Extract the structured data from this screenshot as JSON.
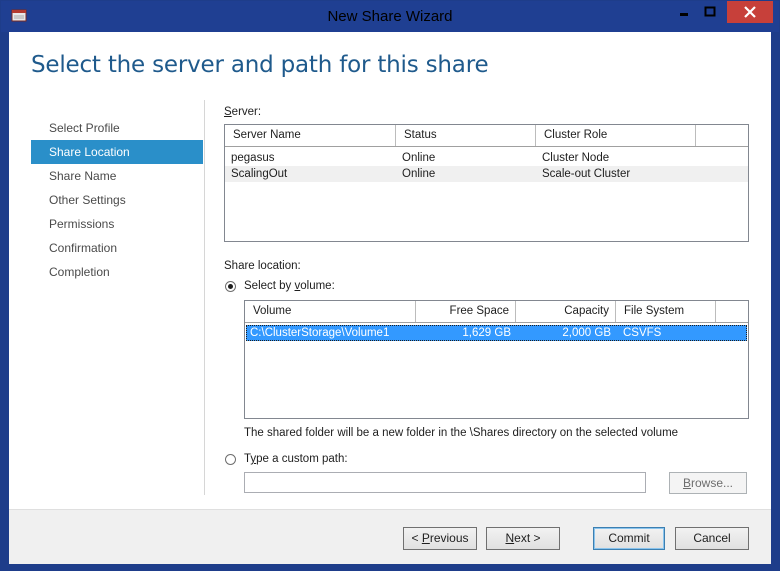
{
  "window": {
    "title": "New Share Wizard",
    "minimize_label": "minimize",
    "maximize_label": "maximize",
    "close_label": "close"
  },
  "heading": "Select the server and path for this share",
  "nav": {
    "items": [
      {
        "label": "Select Profile",
        "active": false
      },
      {
        "label": "Share Location",
        "active": true
      },
      {
        "label": "Share Name",
        "active": false
      },
      {
        "label": "Other Settings",
        "active": false
      },
      {
        "label": "Permissions",
        "active": false
      },
      {
        "label": "Confirmation",
        "active": false
      },
      {
        "label": "Completion",
        "active": false
      }
    ]
  },
  "server": {
    "label_prefix": "",
    "label_underline": "S",
    "label_rest": "erver:",
    "columns": [
      "Server Name",
      "Status",
      "Cluster Role",
      ""
    ],
    "rows": [
      {
        "name": "pegasus",
        "status": "Online",
        "role": "Cluster Node"
      },
      {
        "name": "ScalingOut",
        "status": "Online",
        "role": "Scale-out Cluster"
      }
    ]
  },
  "share_location": {
    "label": "Share location:",
    "by_volume_prefix": "Select by ",
    "by_volume_underline": "v",
    "by_volume_rest": "olume:",
    "volume_columns": [
      "Volume",
      "Free Space",
      "Capacity",
      "File System",
      ""
    ],
    "volumes": [
      {
        "volume": "C:\\ClusterStorage\\Volume1",
        "free": "1,629 GB",
        "capacity": "2,000 GB",
        "fs": "CSVFS"
      }
    ],
    "note": "The shared folder will be a new folder in the \\Shares directory on the selected volume",
    "custom_prefix": "T",
    "custom_underline": "y",
    "custom_rest": "pe a custom path:",
    "custom_value": "",
    "browse_underline": "B",
    "browse_rest": "rowse..."
  },
  "footer": {
    "previous_prefix": "< ",
    "previous_underline": "P",
    "previous_rest": "revious",
    "next_underline": "N",
    "next_rest": "ext >",
    "commit": "Commit",
    "cancel": "Cancel"
  }
}
